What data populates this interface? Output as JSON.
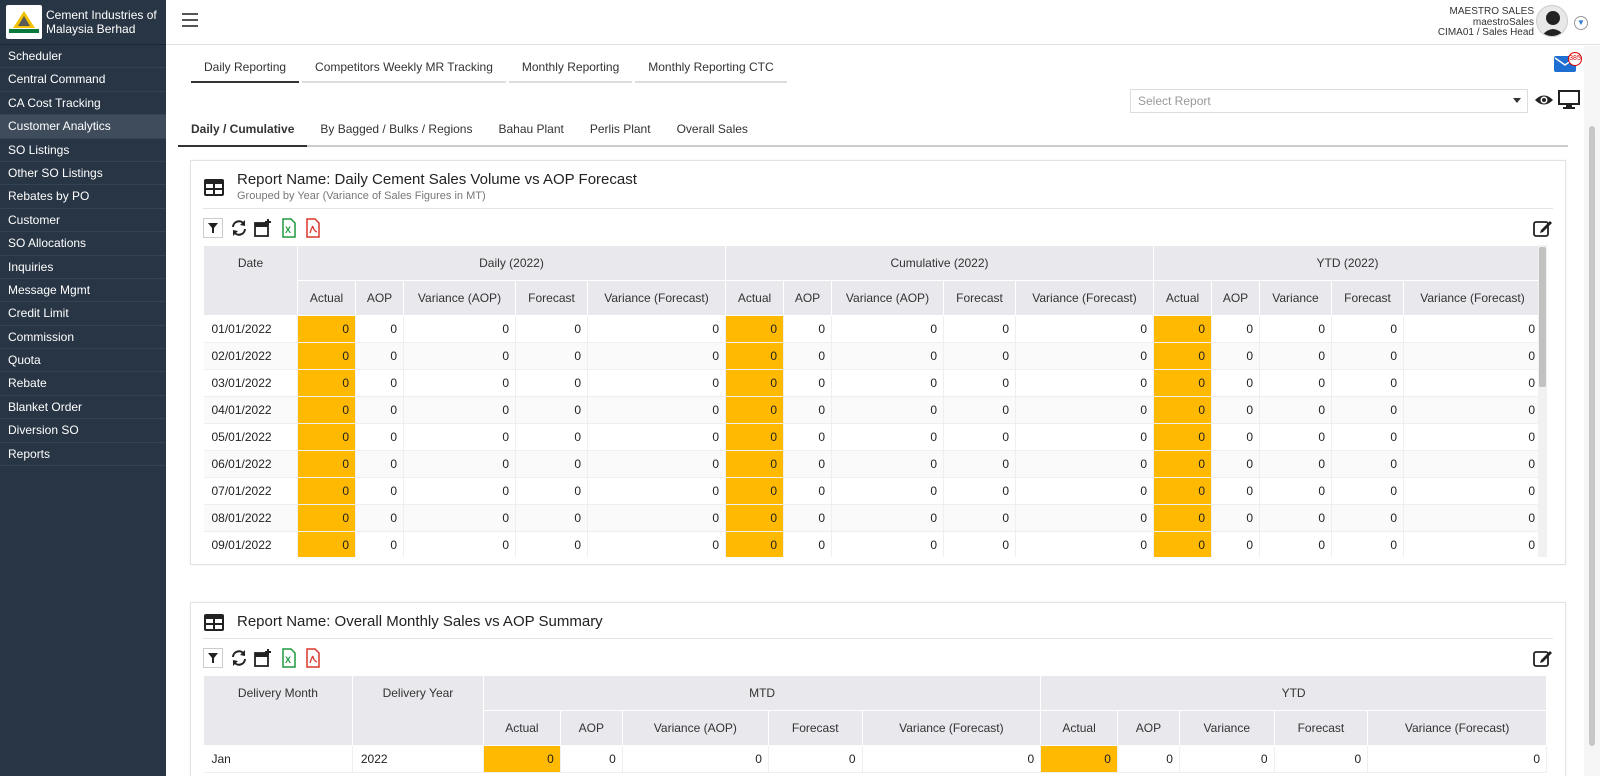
{
  "brand": {
    "name_line1": "Cement Industries of",
    "name_line2": "Malaysia Berhad"
  },
  "sidebar": {
    "items": [
      {
        "label": "Scheduler"
      },
      {
        "label": "Central Command"
      },
      {
        "label": "CA Cost Tracking"
      },
      {
        "label": "Customer Analytics",
        "active": true
      },
      {
        "label": "SO Listings"
      },
      {
        "label": "Other SO Listings"
      },
      {
        "label": "Rebates by PO"
      },
      {
        "label": "Customer"
      },
      {
        "label": "SO Allocations"
      },
      {
        "label": "Inquiries"
      },
      {
        "label": "Message Mgmt"
      },
      {
        "label": "Credit Limit"
      },
      {
        "label": "Commission"
      },
      {
        "label": "Quota"
      },
      {
        "label": "Rebate"
      },
      {
        "label": "Blanket Order"
      },
      {
        "label": "Diversion SO"
      },
      {
        "label": "Reports"
      }
    ]
  },
  "user": {
    "name": "MAESTRO SALES",
    "username": "maestroSales",
    "role": "CIMA01 / Sales Head"
  },
  "notifications": {
    "count": "385"
  },
  "tabs_primary": [
    "Daily Reporting",
    "Competitors Weekly MR Tracking",
    "Monthly Reporting",
    "Monthly Reporting CTC"
  ],
  "select_report": {
    "placeholder": "Select Report"
  },
  "tabs_secondary": [
    "Daily / Cumulative",
    "By Bagged / Bulks / Regions",
    "Bahau Plant",
    "Perlis Plant",
    "Overall Sales"
  ],
  "report1": {
    "title": "Report Name: Daily Cement Sales Volume vs AOP Forecast",
    "subtitle": "Grouped by Year (Variance of Sales Figures in MT)",
    "col_date": "Date",
    "groups": [
      "Daily (2022)",
      "Cumulative (2022)",
      "YTD (2022)"
    ],
    "subcols_a": [
      "Actual",
      "AOP",
      "Variance (AOP)",
      "Forecast",
      "Variance (Forecast)"
    ],
    "subcols_ytd": [
      "Actual",
      "AOP",
      "Variance",
      "Forecast",
      "Variance (Forecast)"
    ],
    "rows": [
      {
        "date": "01/01/2022",
        "vals": [
          "0",
          "0",
          "0",
          "0",
          "0",
          "0",
          "0",
          "0",
          "0",
          "0",
          "0",
          "0",
          "0",
          "0",
          "0"
        ]
      },
      {
        "date": "02/01/2022",
        "vals": [
          "0",
          "0",
          "0",
          "0",
          "0",
          "0",
          "0",
          "0",
          "0",
          "0",
          "0",
          "0",
          "0",
          "0",
          "0"
        ]
      },
      {
        "date": "03/01/2022",
        "vals": [
          "0",
          "0",
          "0",
          "0",
          "0",
          "0",
          "0",
          "0",
          "0",
          "0",
          "0",
          "0",
          "0",
          "0",
          "0"
        ]
      },
      {
        "date": "04/01/2022",
        "vals": [
          "0",
          "0",
          "0",
          "0",
          "0",
          "0",
          "0",
          "0",
          "0",
          "0",
          "0",
          "0",
          "0",
          "0",
          "0"
        ]
      },
      {
        "date": "05/01/2022",
        "vals": [
          "0",
          "0",
          "0",
          "0",
          "0",
          "0",
          "0",
          "0",
          "0",
          "0",
          "0",
          "0",
          "0",
          "0",
          "0"
        ]
      },
      {
        "date": "06/01/2022",
        "vals": [
          "0",
          "0",
          "0",
          "0",
          "0",
          "0",
          "0",
          "0",
          "0",
          "0",
          "0",
          "0",
          "0",
          "0",
          "0"
        ]
      },
      {
        "date": "07/01/2022",
        "vals": [
          "0",
          "0",
          "0",
          "0",
          "0",
          "0",
          "0",
          "0",
          "0",
          "0",
          "0",
          "0",
          "0",
          "0",
          "0"
        ]
      },
      {
        "date": "08/01/2022",
        "vals": [
          "0",
          "0",
          "0",
          "0",
          "0",
          "0",
          "0",
          "0",
          "0",
          "0",
          "0",
          "0",
          "0",
          "0",
          "0"
        ]
      },
      {
        "date": "09/01/2022",
        "vals": [
          "0",
          "0",
          "0",
          "0",
          "0",
          "0",
          "0",
          "0",
          "0",
          "0",
          "0",
          "0",
          "0",
          "0",
          "0"
        ]
      }
    ]
  },
  "report2": {
    "title": "Report Name: Overall Monthly Sales vs AOP Summary",
    "col_month": "Delivery Month",
    "col_year": "Delivery Year",
    "groups": [
      "MTD",
      "YTD"
    ],
    "subcols_mtd": [
      "Actual",
      "AOP",
      "Variance (AOP)",
      "Forecast",
      "Variance (Forecast)"
    ],
    "subcols_ytd": [
      "Actual",
      "AOP",
      "Variance",
      "Forecast",
      "Variance (Forecast)"
    ],
    "rows": [
      {
        "month": "Jan",
        "year": "2022",
        "vals": [
          "0",
          "0",
          "0",
          "0",
          "0",
          "0",
          "0",
          "0",
          "0",
          "0"
        ]
      }
    ]
  },
  "colors": {
    "sidebar_bg": "#283544",
    "highlight": "#ffb900",
    "accent": "#1f6fd2"
  }
}
